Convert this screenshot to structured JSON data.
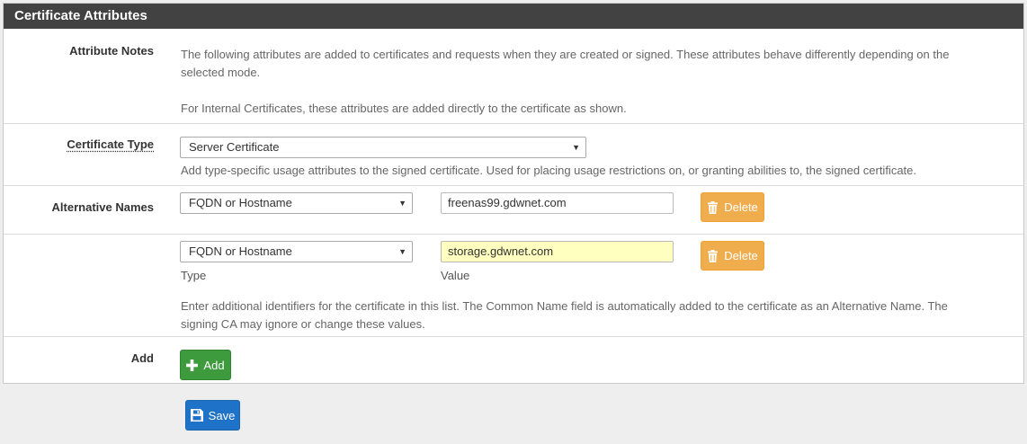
{
  "panel": {
    "title": "Certificate Attributes"
  },
  "attribute_notes": {
    "label": "Attribute Notes",
    "text1_line1": "The following attributes are added to certificates and requests when they are created or signed. These attributes behave differently depending on the",
    "text1_line2": "selected mode.",
    "text2": "For Internal Certificates, these attributes are added directly to the certificate as shown."
  },
  "certificate_type": {
    "label": "Certificate Type",
    "selected": "Server Certificate",
    "help": "Add type-specific usage attributes to the signed certificate. Used for placing usage restrictions on, or granting abilities to, the signed certificate."
  },
  "alternative_names": {
    "label": "Alternative Names",
    "rows": [
      {
        "type": "FQDN or Hostname",
        "value": "freenas99.gdwnet.com",
        "delete_label": "Delete"
      },
      {
        "type": "FQDN or Hostname",
        "value": "storage.gdwnet.com",
        "delete_label": "Delete"
      }
    ],
    "type_caption": "Type",
    "value_caption": "Value",
    "help_line1": "Enter additional identifiers for the certificate in this list. The Common Name field is automatically added to the certificate as an Alternative Name. The",
    "help_line2": "signing CA may ignore or change these values."
  },
  "add": {
    "label": "Add",
    "button_label": "Add"
  },
  "save": {
    "button_label": "Save"
  },
  "colors": {
    "header_bg": "#424242",
    "warning": "#f0ad4e",
    "success": "#3d9b3d",
    "primary": "#1e73c8",
    "highlight": "#ffffbf"
  },
  "icons": {
    "delete": "trash-icon",
    "add": "plus-icon",
    "save": "floppy-disk-icon",
    "select_arrow": "caret-down-icon"
  }
}
